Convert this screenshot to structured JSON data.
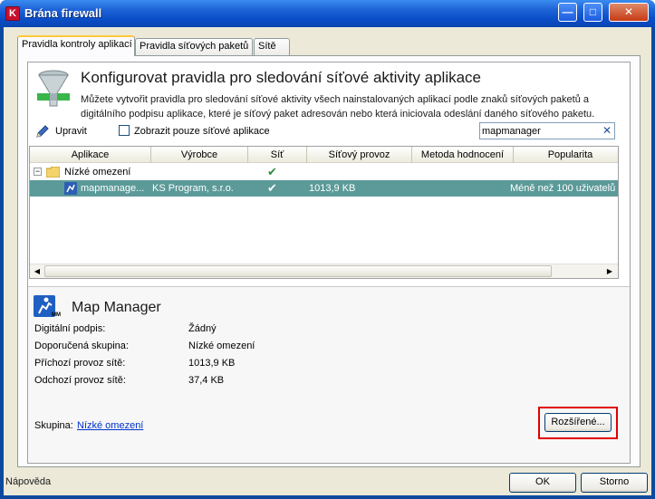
{
  "window": {
    "title": "Brána firewall",
    "icon_label": "K"
  },
  "title_buttons": {
    "minimize": "—",
    "maximize": "□",
    "close": "✕"
  },
  "tabs": [
    {
      "label": "Pravidla kontroly aplikací",
      "active": true
    },
    {
      "label": "Pravidla síťových paketů",
      "active": false
    },
    {
      "label": "Sítě",
      "active": false
    }
  ],
  "header": {
    "title": "Konfigurovat pravidla pro sledování síťové aktivity aplikace",
    "description": "Můžete vytvořit pravidla pro sledování síťové aktivity všech nainstalovaných aplikací podle znaků síťových paketů a digitálního podpisu aplikace, které je síťový paket adresován nebo která iniciovala odeslání daného síťového paketu."
  },
  "toolbar": {
    "edit_label": "Upravit",
    "show_network_only_label": "Zobrazit pouze síťové aplikace",
    "show_network_only_checked": false,
    "search_value": "mapmanager",
    "search_clear": "✕"
  },
  "grid": {
    "columns": [
      "Aplikace",
      "Výrobce",
      "Síť",
      "Síťový provoz",
      "Metoda hodnocení",
      "Popularita"
    ],
    "group": {
      "name": "Nízké omezení",
      "expander": "−",
      "network": "✔"
    },
    "rows": [
      {
        "app": "mapmanage...",
        "vendor": "KS Program, s.r.o.",
        "network": "✔",
        "traffic": "1013,9 KB",
        "method": "",
        "popularity": "Méně než 100 uživatelů"
      }
    ],
    "scroll_left": "◀",
    "scroll_right": "▶"
  },
  "details": {
    "app_name": "Map Manager",
    "app_icon_badge": "MM",
    "fields": [
      {
        "label": "Digitální podpis:",
        "value": "Žádný"
      },
      {
        "label": "Doporučená skupina:",
        "value": "Nízké omezení"
      },
      {
        "label": "Příchozí provoz sítě:",
        "value": "1013,9 KB"
      },
      {
        "label": "Odchozí provoz sítě:",
        "value": "37,4 KB"
      }
    ],
    "group_label": "Skupina:",
    "group_link": "Nízké omezení",
    "advanced_button": "Rozšířené..."
  },
  "footer": {
    "help": "Nápověda",
    "ok": "OK",
    "cancel": "Storno"
  },
  "colors": {
    "selection": "#5b9a99",
    "title_bar": "#0a4ec8",
    "highlight_box": "#e00000",
    "link": "#0033cc"
  }
}
